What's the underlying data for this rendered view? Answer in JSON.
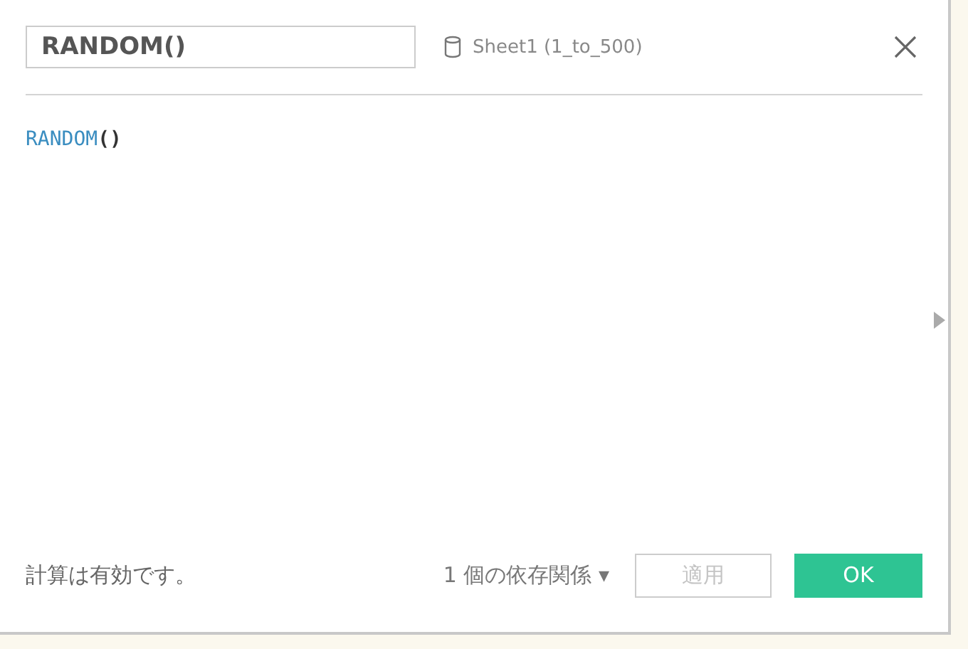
{
  "name_field": {
    "value": "RANDOM()"
  },
  "data_source": "Sheet1 (1_to_500)",
  "formula": [
    {
      "kind": "function",
      "text": "RANDOM"
    },
    {
      "kind": "paren",
      "text": "()"
    }
  ],
  "status": "計算は有効です。",
  "dependencies": "1 個の依存関係 ▾",
  "buttons": [
    {
      "label": "適用",
      "kind": "secondary",
      "disabled": true
    },
    {
      "label": "OK",
      "kind": "primary",
      "disabled": false
    }
  ]
}
